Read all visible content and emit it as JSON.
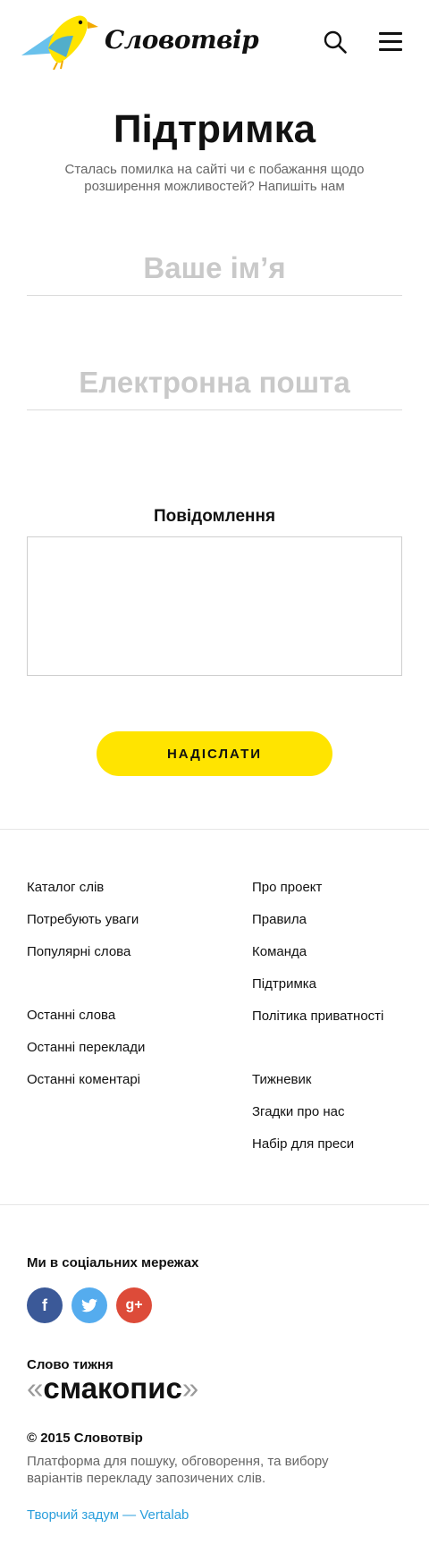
{
  "header": {
    "logo_text": "Словотвір",
    "icons": {
      "search": "search-icon",
      "menu": "hamburger-menu-icon"
    }
  },
  "main": {
    "title": "Підтримка",
    "subtitle": "Сталась помилка на сайті чи є побажання щодо розширення можливостей? Напишіть нам",
    "form": {
      "name_placeholder": "Ваше ім’я",
      "email_placeholder": "Електронна пошта",
      "message_label": "Повідомлення",
      "message_value": "",
      "submit_label": "НАДІСЛАТИ"
    }
  },
  "footer": {
    "links_left": [
      "Каталог слів",
      "Потребують уваги",
      "Популярні слова",
      "Останні слова",
      "Останні переклади",
      "Останні коментарі"
    ],
    "links_right": [
      "Про проект",
      "Правила",
      "Команда",
      "Підтримка",
      "Політика приватності",
      "Тижневик",
      "Згадки про нас",
      "Набір для преси"
    ],
    "social_title": "Ми в соціальних мережах",
    "social": [
      {
        "name": "facebook",
        "glyph": "f",
        "color": "#3b5998"
      },
      {
        "name": "twitter",
        "glyph": "t",
        "color": "#55acee"
      },
      {
        "name": "google-plus",
        "glyph": "g+",
        "color": "#dd4b39"
      }
    ],
    "word_of_week_title": "Слово тижня",
    "word_open_quote": "«",
    "word_of_week": "смакопис",
    "word_close_quote": "»",
    "copyright": "© 2015 Словотвір",
    "description": "Платформа для пошуку, обговорення, та вибору варіантів перекладу запозичених слів.",
    "credit": "Творчий задум — Vertalab"
  },
  "colors": {
    "accent_yellow": "#ffe400",
    "bird_blue": "#3bb0e8",
    "link_blue": "#2b9fdc"
  }
}
